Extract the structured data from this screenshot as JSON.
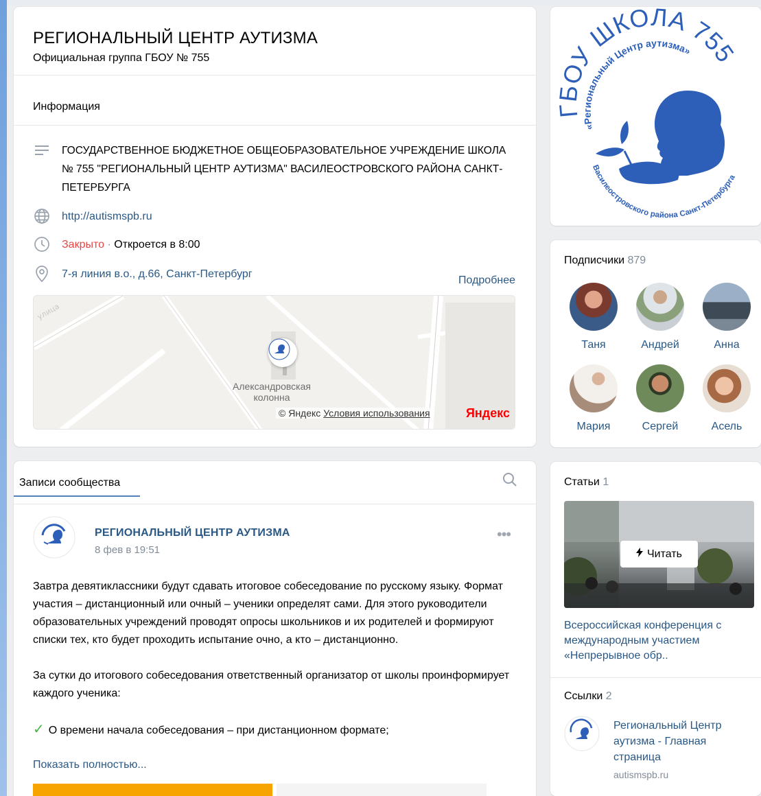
{
  "header": {
    "title": "РЕГИОНАЛЬНЫЙ ЦЕНТР АУТИЗМА",
    "subtitle": "Официальная группа ГБОУ № 755"
  },
  "info": {
    "label": "Информация",
    "description": "ГОСУДАРСТВЕННОЕ БЮДЖЕТНОЕ ОБЩЕОБРАЗОВАТЕЛЬНОЕ УЧРЕЖДЕНИЕ ШКОЛА № 755 \"РЕГИОНАЛЬНЫЙ ЦЕНТР АУТИЗМА\" ВАСИЛЕОСТРОВСКОГО РАЙОНА САНКТ-ПЕТЕРБУРГА",
    "website": "http://autismspb.ru",
    "status_closed": "Закрыто",
    "status_dot": "·",
    "status_opens": "Откроется в 8:00",
    "address": "7-я линия в.о., д.66, Санкт-Петербург",
    "more_link": "Подробнее"
  },
  "map": {
    "place_label": "Александровская колонна",
    "copyright": "© Яндекс",
    "terms": "Условия использования",
    "brand": "Яндекс"
  },
  "posts": {
    "tab_label": "Записи сообщества",
    "author": "РЕГИОНАЛЬНЫЙ ЦЕНТР АУТИЗМА",
    "date": "8 фев в 19:51",
    "menu": "•••",
    "paragraph1": "Завтра девятиклассники будут сдавать итоговое собеседование по русскому языку. Формат участия – дистанционный или очный – ученики определят сами. Для этого руководители образовательных учреждений проводят опросы школьников и их родителей и формируют списки тех, кто будет проходить испытание очно, а кто – дистанционно.",
    "paragraph2": "За сутки до итогового собеседования ответственный организатор от школы проинформирует каждого ученика:",
    "check_mark": "✓",
    "bullet1": "О времени начала собеседования – при дистанционном формате;",
    "show_more": "Показать полностью..."
  },
  "logo": {
    "top_text": "ГБОУ ШКОЛА 755",
    "inner_text": "«Региональный Центр аутизма»",
    "bottom_text": "Василеостровского района Санкт-Петербурга"
  },
  "subscribers": {
    "title": "Подписчики",
    "count": "879",
    "people": [
      {
        "name": "Таня",
        "color": "#7a4a3a"
      },
      {
        "name": "Андрей",
        "color": "#9aa3a8"
      },
      {
        "name": "Анна",
        "color": "#4a5a6a"
      },
      {
        "name": "Мария",
        "color": "#d8cfc7"
      },
      {
        "name": "Сергей",
        "color": "#5a6a3a"
      },
      {
        "name": "Асель",
        "color": "#c9a088"
      }
    ]
  },
  "articles": {
    "title": "Статьи",
    "count": "1",
    "read_button": "Читать",
    "description": "Всероссийская конференция с международным участием «Непрерывное обр.."
  },
  "links": {
    "title": "Ссылки",
    "count": "2",
    "item_name": "Региональный Центр аутизма - Главная страница",
    "item_url": "autismspb.ru"
  },
  "colors": {
    "accent": "#2a5885",
    "closed": "#e64646",
    "logo_blue": "#2d5fb8"
  }
}
